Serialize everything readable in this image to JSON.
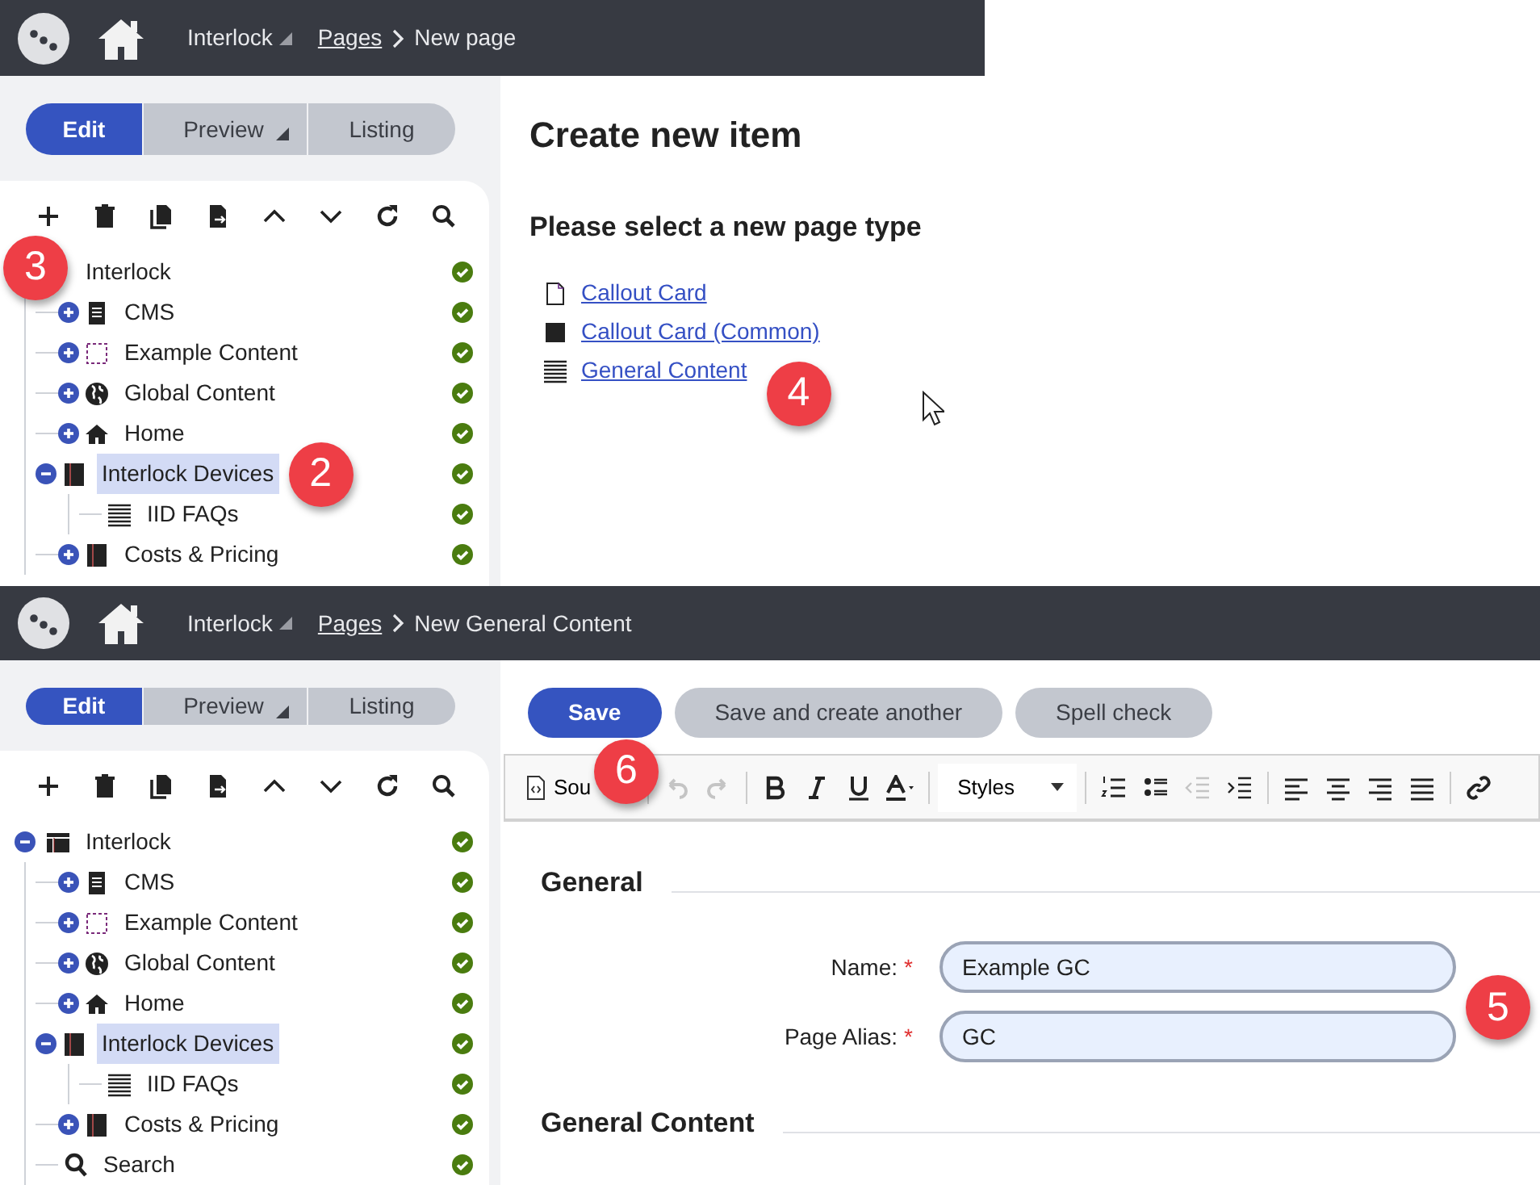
{
  "screens": [
    {
      "header": {
        "site": "Interlock",
        "breadcrumb": [
          {
            "text": "Pages",
            "link": true
          },
          {
            "text": "New page",
            "link": false
          }
        ]
      },
      "mode_tabs": [
        {
          "label": "Edit",
          "selected": true,
          "dropdown": false
        },
        {
          "label": "Preview",
          "selected": false,
          "dropdown": true
        },
        {
          "label": "Listing",
          "selected": false,
          "dropdown": false
        }
      ],
      "tree": [
        {
          "label": "Interlock",
          "selected": false,
          "published": true,
          "marker": "3",
          "children": [
            {
              "label": "CMS",
              "kind": "doc",
              "expanded": false,
              "selected": false,
              "published": true
            },
            {
              "label": "Example Content",
              "kind": "dotted",
              "expanded": false,
              "selected": false,
              "published": true
            },
            {
              "label": "Global Content",
              "kind": "globe",
              "expanded": false,
              "selected": false,
              "published": true
            },
            {
              "label": "Home",
              "kind": "home",
              "expanded": false,
              "selected": false,
              "published": true
            },
            {
              "label": "Interlock Devices",
              "kind": "book",
              "expanded": true,
              "selected": true,
              "published": true,
              "marker": "2",
              "children": [
                {
                  "label": "IID FAQs",
                  "kind": "lines",
                  "selected": false,
                  "published": true
                }
              ]
            },
            {
              "label": "Costs & Pricing",
              "kind": "book",
              "expanded": false,
              "selected": false,
              "published": true
            }
          ]
        }
      ],
      "main": {
        "kind": "chooser",
        "title": "Create new item",
        "subtitle": "Please select a new page type",
        "page_types": [
          {
            "label": "Callout Card",
            "kind": "blank"
          },
          {
            "label": "Callout Card (Common)",
            "kind": "filled"
          },
          {
            "label": "General Content",
            "kind": "lines",
            "marker": "4"
          }
        ]
      }
    },
    {
      "header": {
        "site": "Interlock",
        "breadcrumb": [
          {
            "text": "Pages",
            "link": true
          },
          {
            "text": "New General Content",
            "link": false
          }
        ]
      },
      "mode_tabs": [
        {
          "label": "Edit",
          "selected": true,
          "dropdown": false
        },
        {
          "label": "Preview",
          "selected": false,
          "dropdown": true
        },
        {
          "label": "Listing",
          "selected": false,
          "dropdown": false
        }
      ],
      "tree": [
        {
          "label": "Interlock",
          "kind": "table",
          "expanded": true,
          "selected": false,
          "published": true,
          "children": [
            {
              "label": "CMS",
              "kind": "doc",
              "expanded": false,
              "selected": false,
              "published": true
            },
            {
              "label": "Example Content",
              "kind": "dotted",
              "expanded": false,
              "selected": false,
              "published": true
            },
            {
              "label": "Global Content",
              "kind": "globe",
              "expanded": false,
              "selected": false,
              "published": true
            },
            {
              "label": "Home",
              "kind": "home",
              "expanded": false,
              "selected": false,
              "published": true
            },
            {
              "label": "Interlock Devices",
              "kind": "book",
              "expanded": true,
              "selected": true,
              "published": true,
              "children": [
                {
                  "label": "IID FAQs",
                  "kind": "lines",
                  "selected": false,
                  "published": true
                }
              ]
            },
            {
              "label": "Costs & Pricing",
              "kind": "book",
              "expanded": false,
              "selected": false,
              "published": true
            },
            {
              "label": "Search",
              "kind": "search",
              "selected": false,
              "published": true
            }
          ]
        }
      ],
      "main": {
        "kind": "form",
        "buttons": [
          {
            "label": "Save",
            "primary": true,
            "marker": "6"
          },
          {
            "label": "Save and create another",
            "primary": false
          },
          {
            "label": "Spell check",
            "primary": false
          }
        ],
        "editor_toolbar": [
          {
            "kind": "source",
            "label": "Sou"
          },
          {
            "kind": "sep"
          },
          {
            "kind": "undo",
            "disabled": true
          },
          {
            "kind": "redo",
            "disabled": true
          },
          {
            "kind": "sep"
          },
          {
            "kind": "bold",
            "disabled": false
          },
          {
            "kind": "italic",
            "disabled": false
          },
          {
            "kind": "underline",
            "disabled": false
          },
          {
            "kind": "color",
            "disabled": false
          },
          {
            "kind": "sep"
          },
          {
            "kind": "styles",
            "label": "Styles"
          },
          {
            "kind": "sep"
          },
          {
            "kind": "numlist",
            "disabled": false
          },
          {
            "kind": "bullist",
            "disabled": false
          },
          {
            "kind": "outdent",
            "disabled": true
          },
          {
            "kind": "indent",
            "disabled": false
          },
          {
            "kind": "sep"
          },
          {
            "kind": "alignleft",
            "disabled": false
          },
          {
            "kind": "aligncenter",
            "disabled": false
          },
          {
            "kind": "alignright",
            "disabled": false
          },
          {
            "kind": "justify",
            "disabled": false
          },
          {
            "kind": "sep"
          },
          {
            "kind": "link",
            "disabled": false
          }
        ],
        "sections": [
          {
            "title": "General",
            "fields": [
              {
                "label": "Name:",
                "required_mark": "*",
                "value": "Example GC"
              },
              {
                "label": "Page Alias:",
                "required_mark": "*",
                "value": "GC",
                "marker": "5"
              }
            ]
          },
          {
            "title": "General Content"
          }
        ]
      }
    }
  ]
}
